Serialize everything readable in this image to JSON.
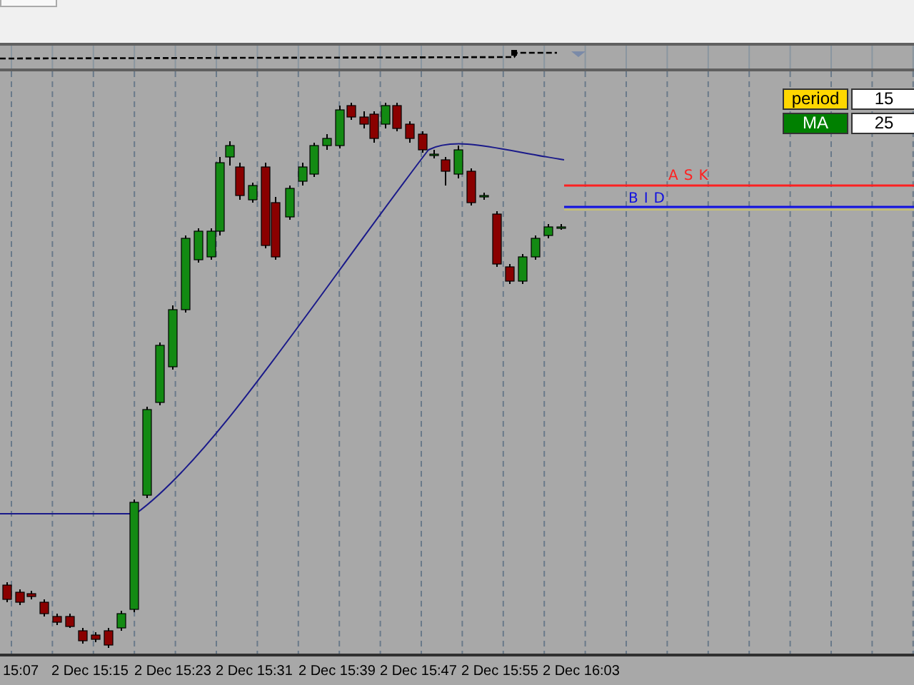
{
  "indicator_panel": {
    "rows": [
      {
        "label": "period",
        "value": "15",
        "color": "#ffd700"
      },
      {
        "label": "MA",
        "value": "25",
        "color": "#008000"
      }
    ]
  },
  "price_lines": [
    {
      "kind": "ask",
      "label": "ASK",
      "color": "#ff2020"
    },
    {
      "kind": "bid",
      "label": "BID",
      "color": "#1010e0"
    }
  ],
  "time_axis": {
    "labels": [
      "15:07",
      "2 Dec 15:15",
      "2 Dec 15:23",
      "2 Dec 15:31",
      "2 Dec 15:39",
      "2 Dec 15:47",
      "2 Dec 15:55",
      "2 Dec 16:03"
    ]
  }
}
